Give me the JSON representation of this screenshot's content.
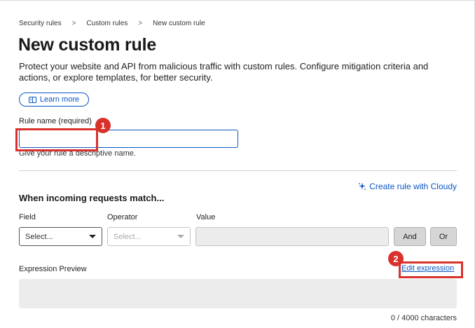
{
  "breadcrumb": {
    "items": [
      "Security rules",
      "Custom rules",
      "New custom rule"
    ],
    "separator": ">"
  },
  "page": {
    "title": "New custom rule",
    "description": "Protect your website and API from malicious traffic with custom rules. Configure mitigation criteria and actions, or explore templates, for better security.",
    "learn_more_label": "Learn more",
    "learn_more_icon": "book-icon"
  },
  "rule_name": {
    "label": "Rule name (required)",
    "value": "",
    "hint": "Give your rule a descriptive name."
  },
  "annotations": {
    "badge_1": "1",
    "badge_2": "2",
    "color": "#d9312b"
  },
  "match_section": {
    "title": "When incoming requests match...",
    "cloudy_link": "Create rule with Cloudy",
    "cloudy_icon": "sparkle-icon",
    "field_label": "Field",
    "operator_label": "Operator",
    "value_label": "Value",
    "field_selected": "Select...",
    "operator_selected": "Select...",
    "and_label": "And",
    "or_label": "Or"
  },
  "expression": {
    "label": "Expression Preview",
    "edit_label": "Edit expression",
    "char_count": "0 / 4000 characters"
  },
  "colors": {
    "accent": "#0a56c2",
    "highlight": "#d9312b"
  }
}
